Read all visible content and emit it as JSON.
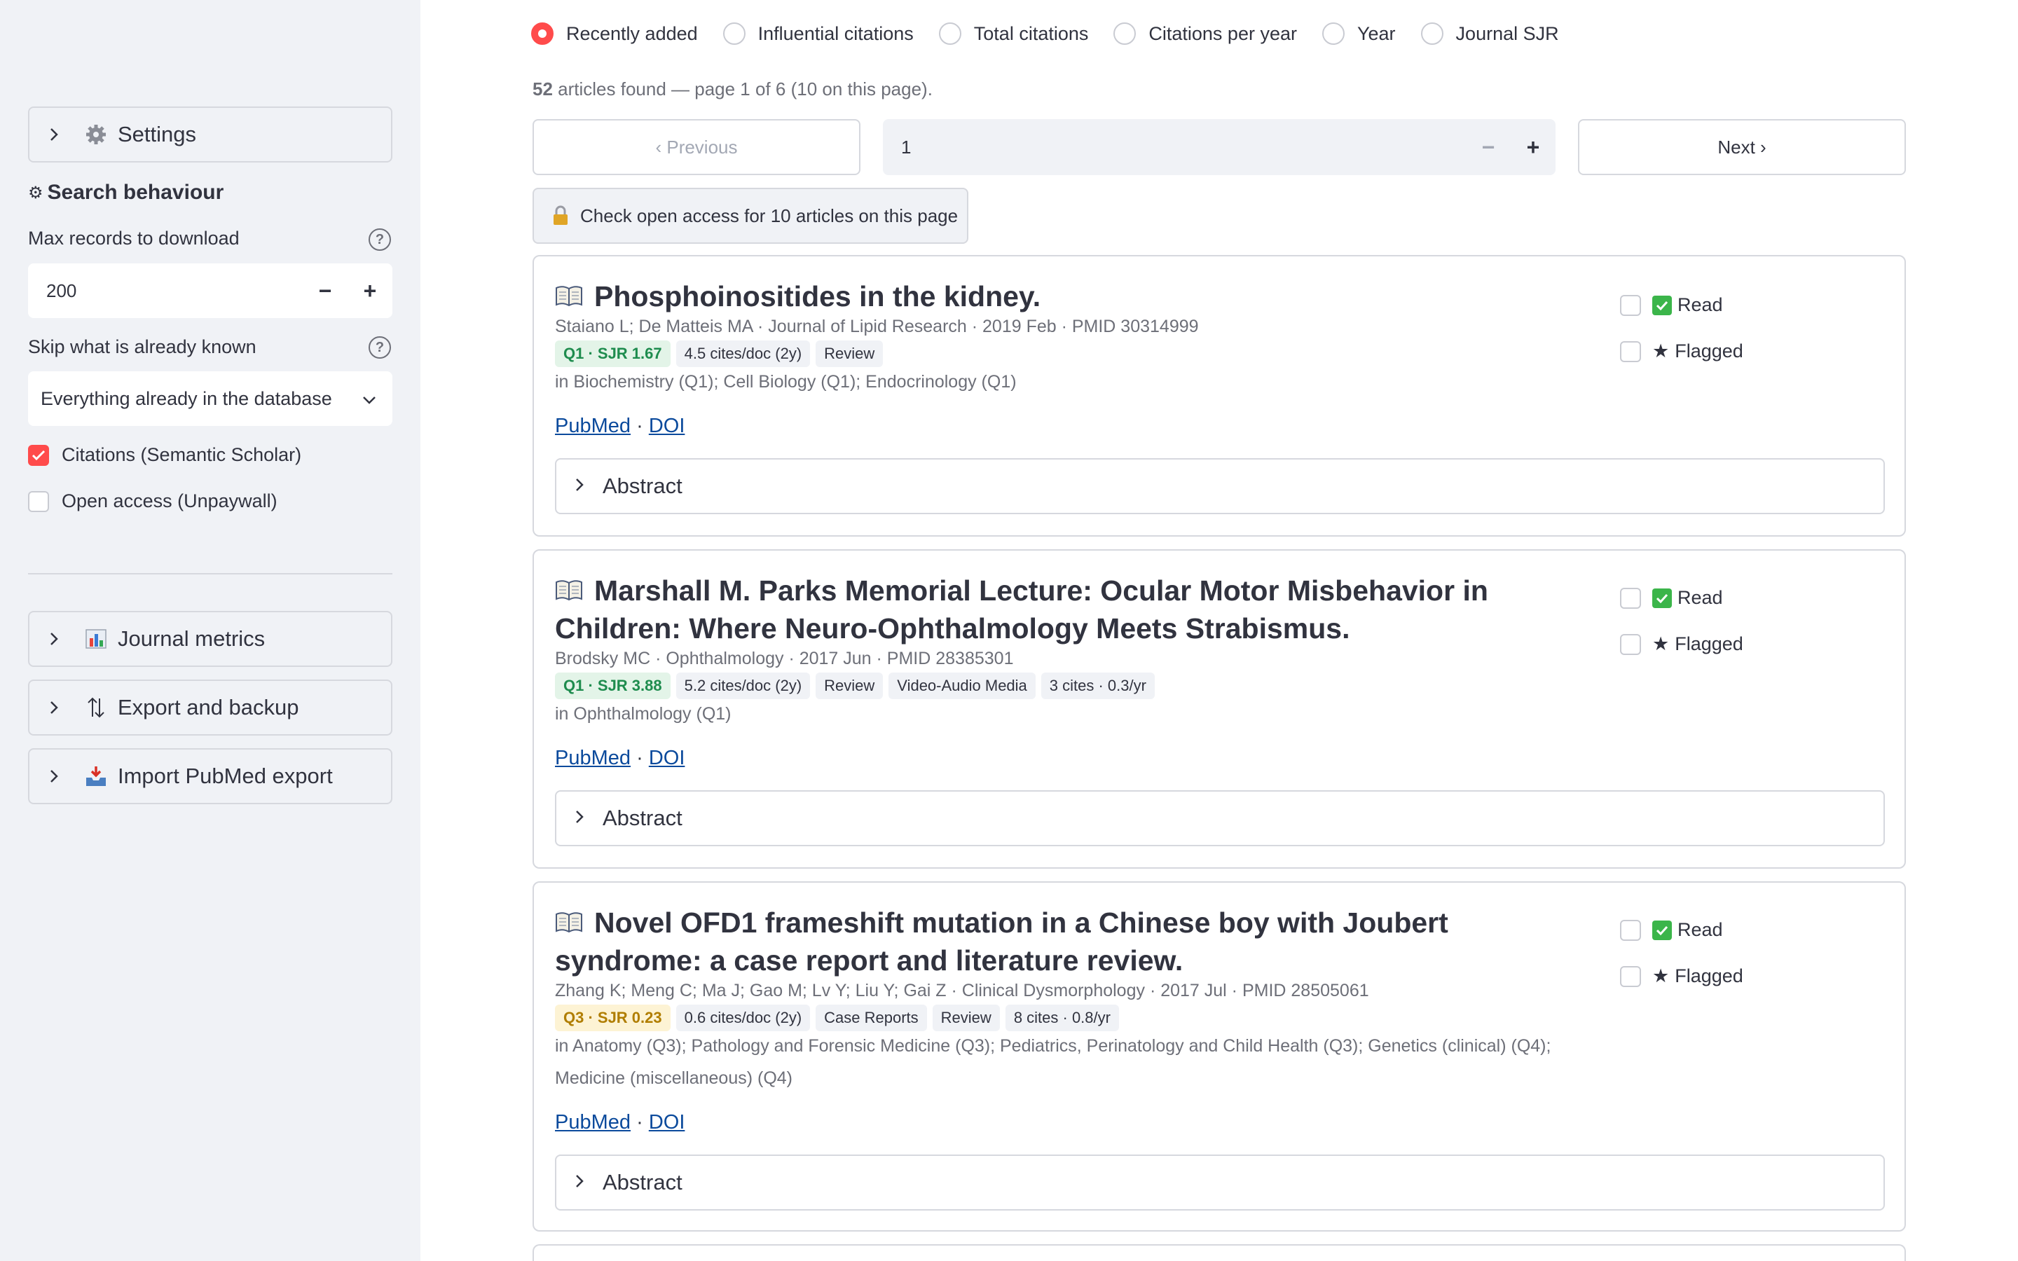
{
  "sidebar": {
    "settings_expander": "Settings",
    "search_heading": "Search behaviour",
    "max_records_label": "Max records to download",
    "max_records_value": "200",
    "skip_label": "Skip what is already known",
    "skip_value": "Everything already in the database",
    "citations_checkbox": "Citations (Semantic Scholar)",
    "citations_checked": true,
    "open_access_checkbox": "Open access (Unpaywall)",
    "open_access_checked": false,
    "journal_metrics_expander": "Journal metrics",
    "export_expander": "Export and backup",
    "import_expander": "Import PubMed export"
  },
  "sort": {
    "options": [
      "Recently added",
      "Influential citations",
      "Total citations",
      "Citations per year",
      "Year",
      "Journal SJR"
    ],
    "selected": "Recently added"
  },
  "results": {
    "count": "52",
    "summary": "articles found — page 1 of 6 (10 on this page)."
  },
  "pagination": {
    "previous_label": "‹ Previous",
    "page_value": "1",
    "next_label": "Next ›",
    "minus": "−",
    "plus": "+"
  },
  "open_access_button": "Check open access for 10 articles on this page",
  "articles": [
    {
      "title": "Phosphoinositides in the kidney.",
      "meta": "Staiano L; De Matteis MA · Journal of Lipid Research · 2019 Feb · PMID 30314999",
      "badges": [
        "Q1 · SJR 1.67",
        "4.5 cites/doc (2y)",
        "Review"
      ],
      "categories": "in Biochemistry (Q1); Cell Biology (Q1); Endocrinology (Q1)",
      "links": [
        "PubMed",
        "DOI"
      ],
      "link_sep": "·",
      "abstract_label": "Abstract",
      "read_label": "Read",
      "flagged_label": "Flagged"
    },
    {
      "title": "Marshall M. Parks Memorial Lecture: Ocular Motor Misbehavior in Children: Where Neuro-Ophthalmology Meets Strabismus.",
      "meta": "Brodsky MC · Ophthalmology · 2017 Jun · PMID 28385301",
      "badges": [
        "Q1 · SJR 3.88",
        "5.2 cites/doc (2y)",
        "Review",
        "Video-Audio Media",
        "3 cites · 0.3/yr"
      ],
      "categories": "in Ophthalmology (Q1)",
      "links": [
        "PubMed",
        "DOI"
      ],
      "link_sep": "·",
      "abstract_label": "Abstract",
      "read_label": "Read",
      "flagged_label": "Flagged"
    },
    {
      "title": "Novel OFD1 frameshift mutation in a Chinese boy with Joubert syndrome: a case report and literature review.",
      "meta": "Zhang K; Meng C; Ma J; Gao M; Lv Y; Liu Y; Gai Z · Clinical Dysmorphology · 2017 Jul · PMID 28505061",
      "badges": [
        "Q3 · SJR 0.23",
        "0.6 cites/doc (2y)",
        "Case Reports",
        "Review",
        "8 cites · 0.8/yr"
      ],
      "categories": "in Anatomy (Q3); Pathology and Forensic Medicine (Q3); Pediatrics, Perinatology and Child Health (Q3); Genetics (clinical) (Q4); Medicine (miscellaneous) (Q4)",
      "links": [
        "PubMed",
        "DOI"
      ],
      "link_sep": "·",
      "abstract_label": "Abstract",
      "read_label": "Read",
      "flagged_label": "Flagged"
    }
  ],
  "colors": {
    "accent": "#ff4b4b",
    "sidebar_bg": "#f0f2f6",
    "q1_text": "#1e8c4e",
    "q3_text": "#b07d00",
    "link": "#0b4a9c",
    "read_check": "#3bb54a"
  }
}
